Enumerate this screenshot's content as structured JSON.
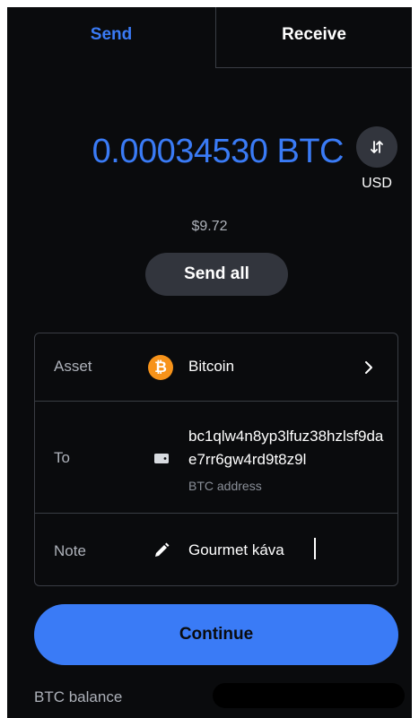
{
  "tabs": {
    "send": "Send",
    "receive": "Receive"
  },
  "amount": {
    "value": "0.00034530 BTC",
    "swap_currency": "USD",
    "fiat_value": "$9.72",
    "send_all_label": "Send all"
  },
  "form": {
    "asset": {
      "label": "Asset",
      "icon": "bitcoin-icon",
      "icon_glyph": "₿",
      "name": "Bitcoin"
    },
    "to": {
      "label": "To",
      "icon": "wallet-icon",
      "address": "bc1qlw4n8yp3lfuz38hzlsf9dae7rr6gw4rd9t8z9l",
      "address_type": "BTC address"
    },
    "note": {
      "label": "Note",
      "icon": "pencil-icon",
      "value": "Gourmet káva"
    }
  },
  "continue_label": "Continue",
  "balance": {
    "label": "BTC balance"
  },
  "colors": {
    "accent": "#3a7bf6",
    "background": "#0a0b0d",
    "surface": "#32353d",
    "bitcoin": "#f7931a"
  }
}
